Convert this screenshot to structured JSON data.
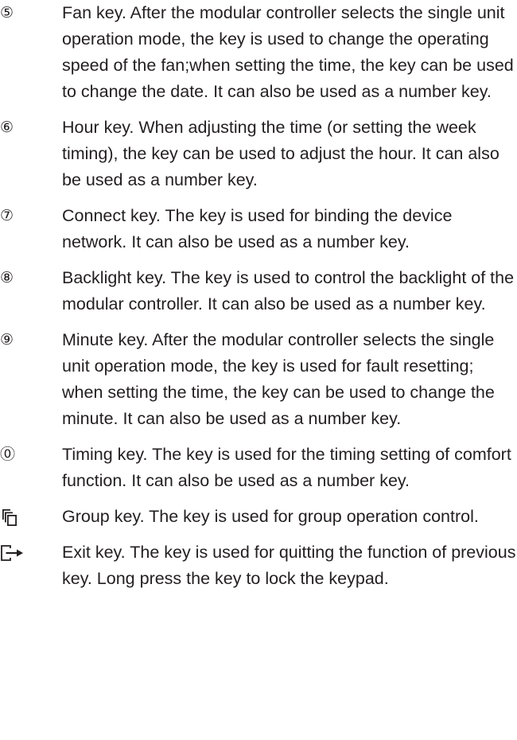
{
  "keys": [
    {
      "marker": "⑤",
      "text": "Fan key. After the modular controller selects the single unit operation mode, the key is used to change the operating speed of the fan;when setting the time, the key can be used to change the date. It can also be used as a number key."
    },
    {
      "marker": "⑥",
      "text": "Hour key. When adjusting the time (or setting the week timing), the key can be used to adjust the hour. It can also be used as a number key."
    },
    {
      "marker": "⑦",
      "text": "Connect key. The key is used for binding the device network. It can also be used as a number key."
    },
    {
      "marker": "⑧",
      "text": "Backlight key. The key is used to control the backlight of the modular controller. It can also be used as a number key."
    },
    {
      "marker": "⑨",
      "text": "Minute key. After the modular controller selects the single unit operation mode, the key is used for fault resetting; when setting the time, the key can be used to change the minute. It can also be used as a number key."
    },
    {
      "marker": "⓪",
      "text": "Timing key. The key is used for the timing setting of comfort function. It can also be used as a number key."
    },
    {
      "marker_icon": "group-icon",
      "text": "Group key. The key is used for group operation control."
    },
    {
      "marker_icon": "exit-icon",
      "text": "Exit key. The key is used for quitting the function of previous key. Long press the key to lock the keypad."
    }
  ]
}
